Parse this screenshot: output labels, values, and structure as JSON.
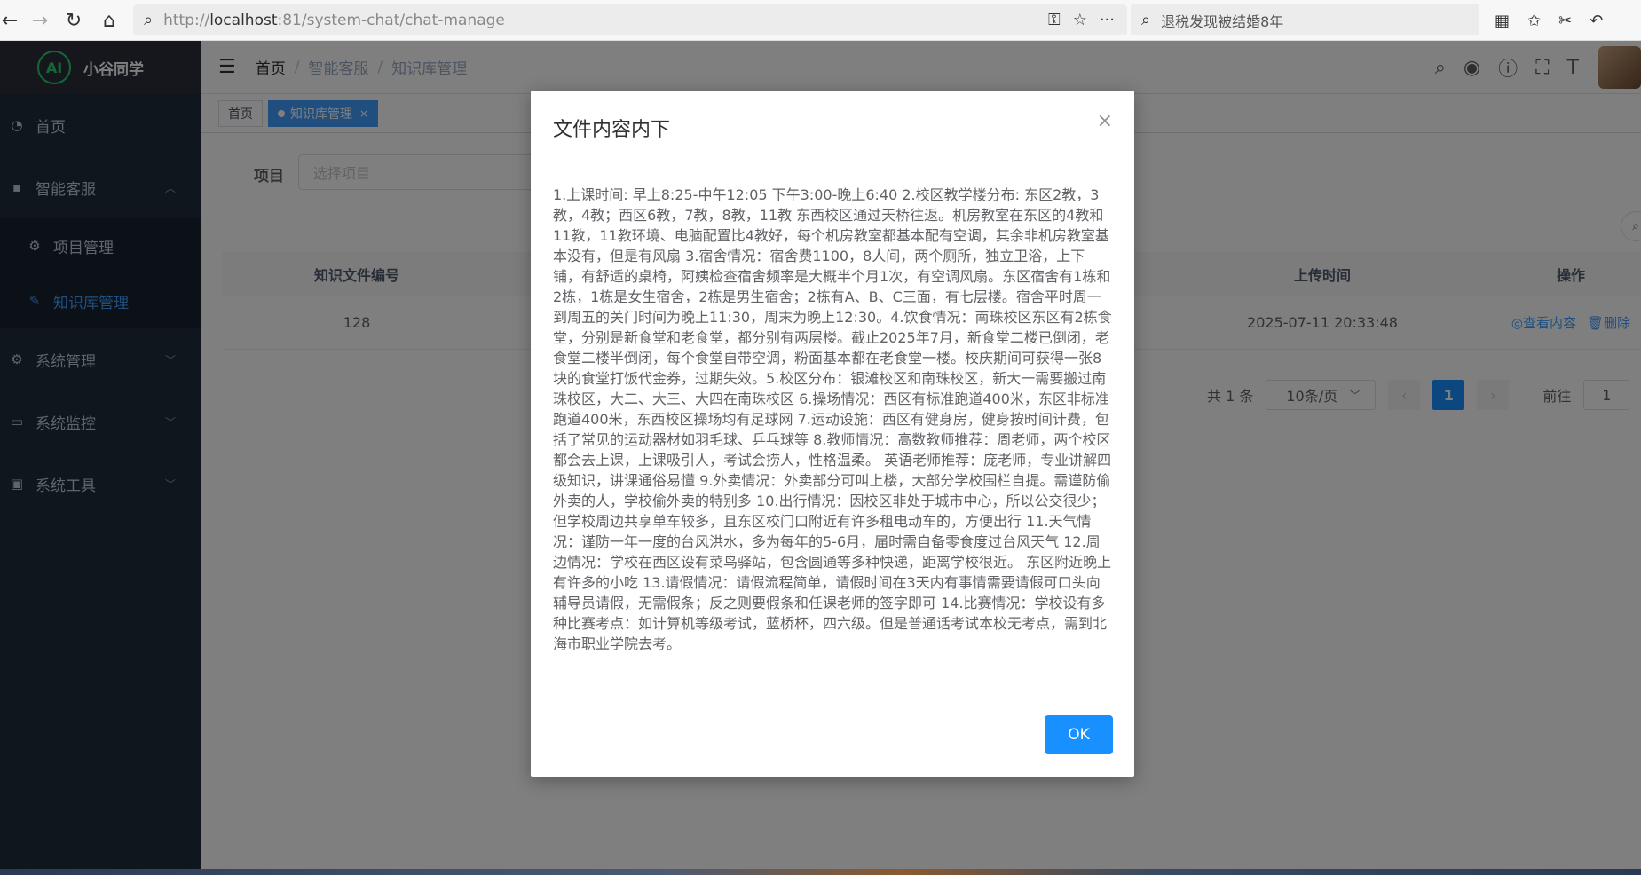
{
  "browser": {
    "url_prefix": "http://",
    "url_host": "localhost",
    "url_rest": ":81/system-chat/chat-manage",
    "search_text": "退税发现被结婚8年"
  },
  "sidebar": {
    "logo_text": "小谷同学",
    "logo_mark": "AI",
    "items": [
      {
        "label": "首页",
        "icon": "dashboard-icon"
      },
      {
        "label": "智能客服",
        "icon": "chat-icon"
      },
      {
        "label": "项目管理",
        "icon": "gear-icon"
      },
      {
        "label": "知识库管理",
        "icon": "edit-icon"
      },
      {
        "label": "系统管理",
        "icon": "gear-icon"
      },
      {
        "label": "系统监控",
        "icon": "monitor-icon"
      },
      {
        "label": "系统工具",
        "icon": "toolbox-icon"
      }
    ]
  },
  "header": {
    "breadcrumb": [
      "首页",
      "智能客服",
      "知识库管理"
    ]
  },
  "tags": {
    "home": "首页",
    "active": "知识库管理",
    "close": "×"
  },
  "filter": {
    "label": "项目",
    "placeholder": "选择项目"
  },
  "table": {
    "columns": [
      "知识文件编号",
      "上传时间",
      "操作"
    ],
    "rows": [
      {
        "id": "128",
        "time": "2025-07-11 20:33:48",
        "view": "查看内容",
        "delete": "删除"
      }
    ]
  },
  "pager": {
    "total": "共 1 条",
    "size": "10条/页",
    "current": "1",
    "goto_label": "前往",
    "goto_value": "1"
  },
  "modal": {
    "title": "文件内容内下",
    "body": "1.上课时间: 早上8:25-中午12:05 下午3:00-晚上6:40 2.校区教学楼分布: 东区2教，3教，4教；西区6教，7教，8教，11教 东西校区通过天桥往返。机房教室在东区的4教和11教，11教环境、电脑配置比4教好，每个机房教室都基本配有空调，其余非机房教室基本没有，但是有风扇 3.宿舍情况：宿舍费1100，8人间，两个厕所，独立卫浴，上下铺，有舒适的桌椅，阿姨检查宿舍频率是大概半个月1次，有空调风扇。东区宿舍有1栋和2栋，1栋是女生宿舍，2栋是男生宿舍；2栋有A、B、C三面，有七层楼。宿舍平时周一到周五的关门时间为晚上11:30，周末为晚上12:30。4.饮食情况：南珠校区东区有2栋食堂，分别是新食堂和老食堂，都分别有两层楼。截止2025年7月，新食堂二楼已倒闭，老食堂二楼半倒闭，每个食堂自带空调，粉面基本都在老食堂一楼。校庆期间可获得一张8块的食堂打饭代金券，过期失效。5.校区分布：银滩校区和南珠校区，新大一需要搬过南珠校区，大二、大三、大四在南珠校区 6.操场情况：西区有标准跑道400米，东区非标准跑道400米，东西校区操场均有足球网 7.运动设施：西区有健身房，健身按时间计费，包括了常见的运动器材如羽毛球、乒乓球等 8.教师情况：高数教师推荐：周老师，两个校区都会去上课，上课吸引人，考试会捞人，性格温柔。 英语老师推荐：庞老师，专业讲解四级知识，讲课通俗易懂 9.外卖情况：外卖部分可叫上楼，大部分学校围栏自提。需谨防偷外卖的人，学校偷外卖的特别多 10.出行情况：因校区非处于城市中心，所以公交很少；但学校周边共享单车较多，且东区校门口附近有许多租电动车的，方便出行 11.天气情况：谨防一年一度的台风洪水，多为每年的5-6月，届时需自备零食度过台风天气 12.周边情况：学校在西区设有菜鸟驿站，包含圆通等多种快递，距离学校很近。 东区附近晚上有许多的小吃 13.请假情况：请假流程简单，请假时间在3天内有事情需要请假可口头向辅导员请假，无需假条；反之则要假条和任课老师的签字即可 14.比赛情况：学校设有多种比赛考点：如计算机等级考试，蓝桥杯，四六级。但是普通话考试本校无考点，需到北海市职业学院去考。",
    "ok_label": "OK",
    "close": "×"
  }
}
